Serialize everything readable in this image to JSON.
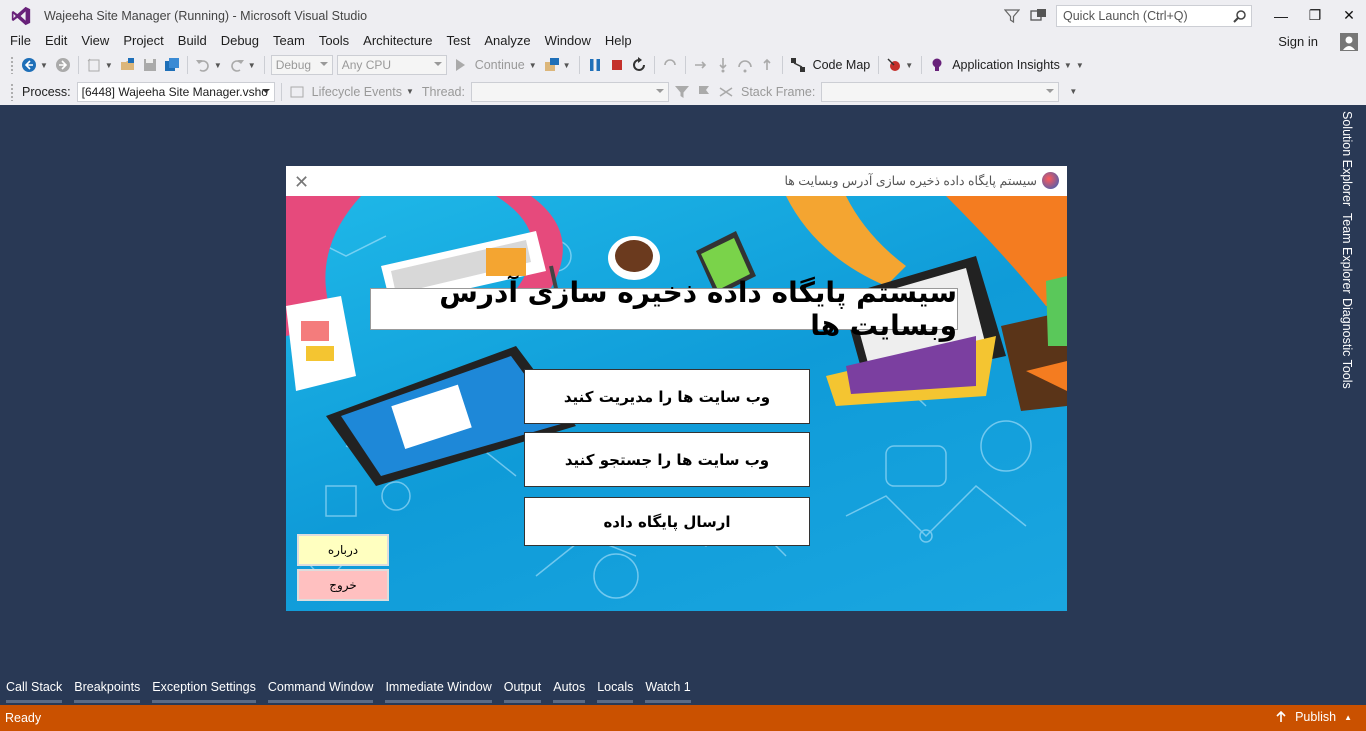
{
  "window": {
    "title": "Wajeeha Site Manager (Running) - Microsoft Visual Studio",
    "quick_launch_placeholder": "Quick Launch (Ctrl+Q)"
  },
  "menu": [
    "File",
    "Edit",
    "View",
    "Project",
    "Build",
    "Debug",
    "Team",
    "Tools",
    "Architecture",
    "Test",
    "Analyze",
    "Window",
    "Help"
  ],
  "account": {
    "sign_in": "Sign in"
  },
  "toolbar1": {
    "config": "Debug",
    "platform": "Any CPU",
    "continue": "Continue",
    "code_map": "Code Map",
    "app_insights": "Application Insights"
  },
  "toolbar2": {
    "process_label": "Process:",
    "process_value": "[6448] Wajeeha Site Manager.vsho",
    "lifecycle": "Lifecycle Events",
    "thread_label": "Thread:",
    "stack_frame_label": "Stack Frame:"
  },
  "side_tabs": [
    "Solution Explorer",
    "Team Explorer",
    "Diagnostic Tools"
  ],
  "app": {
    "title": "سیستم پایگاه داده ذخیره سازی آدرس وبسایت ها",
    "banner": "سیستم پایگاه داده ذخیره سازی آدرس وبسایت ها",
    "manage_btn": "وب سایت ها را مدیریت کنید",
    "search_btn": "وب سایت ها را جستجو کنید",
    "send_db_btn": "ارسال پایگاه داده",
    "about_btn": "درباره",
    "exit_btn": "خروج"
  },
  "bottom_tabs": [
    "Call Stack",
    "Breakpoints",
    "Exception Settings",
    "Command Window",
    "Immediate Window",
    "Output",
    "Autos",
    "Locals",
    "Watch 1"
  ],
  "status": {
    "text": "Ready",
    "publish": "Publish"
  },
  "colors": {
    "ide_background": "#293955",
    "chrome": "#eeeef2",
    "status_bar": "#ca5100",
    "about_button": "#ffffc0",
    "exit_button": "#ffc0c0",
    "app_background": "#1aa6e0"
  }
}
